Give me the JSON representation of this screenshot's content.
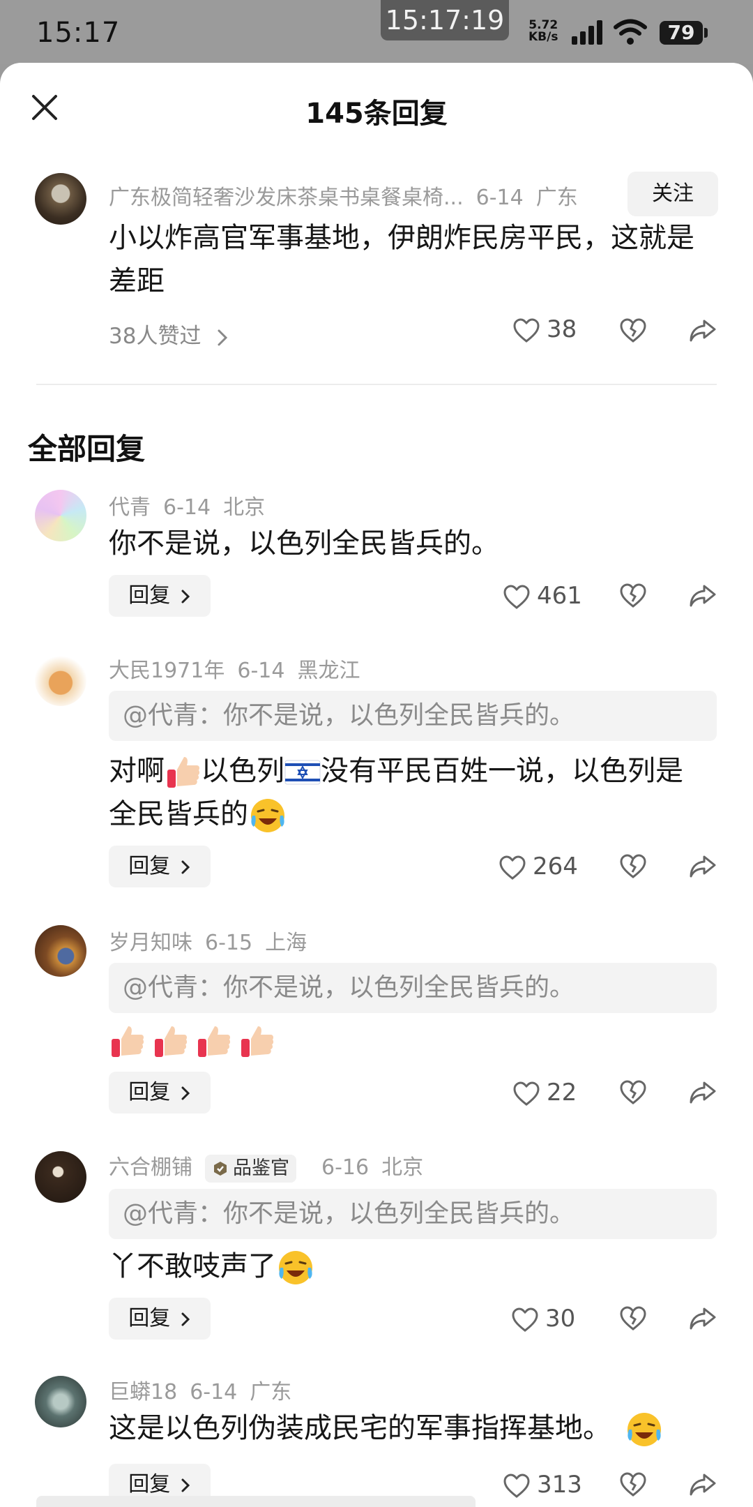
{
  "status": {
    "time": "15:17",
    "clock": "15:17:19",
    "speed_value": "5.72",
    "speed_unit": "KB/s",
    "battery": "79"
  },
  "header": {
    "title": "145条回复"
  },
  "main_comment": {
    "author": "广东极简轻奢沙发床茶桌书桌餐桌椅...",
    "date": "6-14",
    "location": "广东",
    "follow_label": "关注",
    "text": "小以炸高官军事基地，伊朗炸民房平民，这就是差距",
    "likers": "38人赞过",
    "like_count": "38"
  },
  "section": {
    "title": "全部回复"
  },
  "replies": [
    {
      "author": "代青",
      "date": "6-14",
      "location": "北京",
      "text": "你不是说，以色列全民皆兵的。",
      "reply_label": "回复",
      "likes": "461"
    },
    {
      "author": "大民1971年",
      "date": "6-14",
      "location": "黑龙江",
      "quote": "@代青：你不是说，以色列全民皆兵的。",
      "text_a": "对啊",
      "text_b": "以色列",
      "text_c": "没有平民百姓一说，以色列是",
      "text_d": "全民皆兵的",
      "reply_label": "回复",
      "likes": "264"
    },
    {
      "author": "岁月知味",
      "date": "6-15",
      "location": "上海",
      "quote": "@代青：你不是说，以色列全民皆兵的。",
      "reply_label": "回复",
      "likes": "22"
    },
    {
      "author": "六合棚铺",
      "badge": "品鉴官",
      "date": "6-16",
      "location": "北京",
      "quote": "@代青：你不是说，以色列全民皆兵的。",
      "text": "丫不敢吱声了",
      "reply_label": "回复",
      "likes": "30"
    },
    {
      "author": "巨蟒18",
      "date": "6-14",
      "location": "广东",
      "text": "这是以色列伪装成民宅的军事指挥基地。",
      "reply_label": "回复",
      "likes": "313"
    }
  ],
  "icons": {
    "close": "close-icon",
    "like": "heart-icon",
    "dislike": "broken-heart-icon",
    "share": "share-arrow-icon",
    "chevron": "chevron-right-icon"
  }
}
